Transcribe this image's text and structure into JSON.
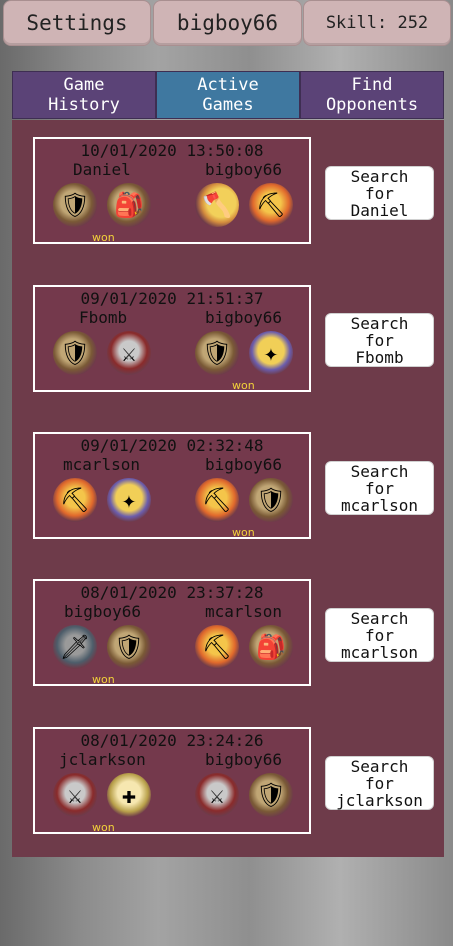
{
  "header": {
    "settings_label": "Settings",
    "username": "bigboy66",
    "skill_label": "Skill: 252"
  },
  "tabs": [
    {
      "label": "Game\nHistory",
      "active": false
    },
    {
      "label": "Active\nGames",
      "active": true
    },
    {
      "label": "Find\nOpponents",
      "active": false
    }
  ],
  "games": [
    {
      "date": "10/01/2020 13:50:08",
      "player1": "Daniel",
      "player2": "bigboy66",
      "won_label": "won",
      "winner": "player1",
      "p1_avatars": [
        "thief-icon",
        "thief-icon"
      ],
      "p2_avatars": [
        "dwarf-icon",
        "miner-icon"
      ],
      "search_label": "Search\nfor\nDaniel"
    },
    {
      "date": "09/01/2020 21:51:37",
      "player1": "Fbomb",
      "player2": "bigboy66",
      "won_label": "won",
      "winner": "player2",
      "p1_avatars": [
        "thief-icon",
        "knight-icon"
      ],
      "p2_avatars": [
        "thief-icon",
        "wizard-icon"
      ],
      "search_label": "Search\nfor\nFbomb"
    },
    {
      "date": "09/01/2020 02:32:48",
      "player1": "mcarlson",
      "player2": "bigboy66",
      "won_label": "won",
      "winner": "player2",
      "p1_avatars": [
        "miner-icon",
        "wizard-icon"
      ],
      "p2_avatars": [
        "miner-icon",
        "thief-icon"
      ],
      "search_label": "Search\nfor\nmcarlson"
    },
    {
      "date": "08/01/2020 23:37:28",
      "player1": "bigboy66",
      "player2": "mcarlson",
      "won_label": "won",
      "winner": "player1",
      "p1_avatars": [
        "rogue-icon",
        "thief-icon"
      ],
      "p2_avatars": [
        "miner-icon",
        "thief-icon"
      ],
      "search_label": "Search\nfor\nmcarlson"
    },
    {
      "date": "08/01/2020 23:24:26",
      "player1": "jclarkson",
      "player2": "bigboy66",
      "won_label": "won",
      "winner": "player1",
      "p1_avatars": [
        "knight-icon",
        "paladin-icon"
      ],
      "p2_avatars": [
        "knight-icon",
        "thief-icon"
      ],
      "search_label": "Search\nfor\njclarkson"
    }
  ]
}
